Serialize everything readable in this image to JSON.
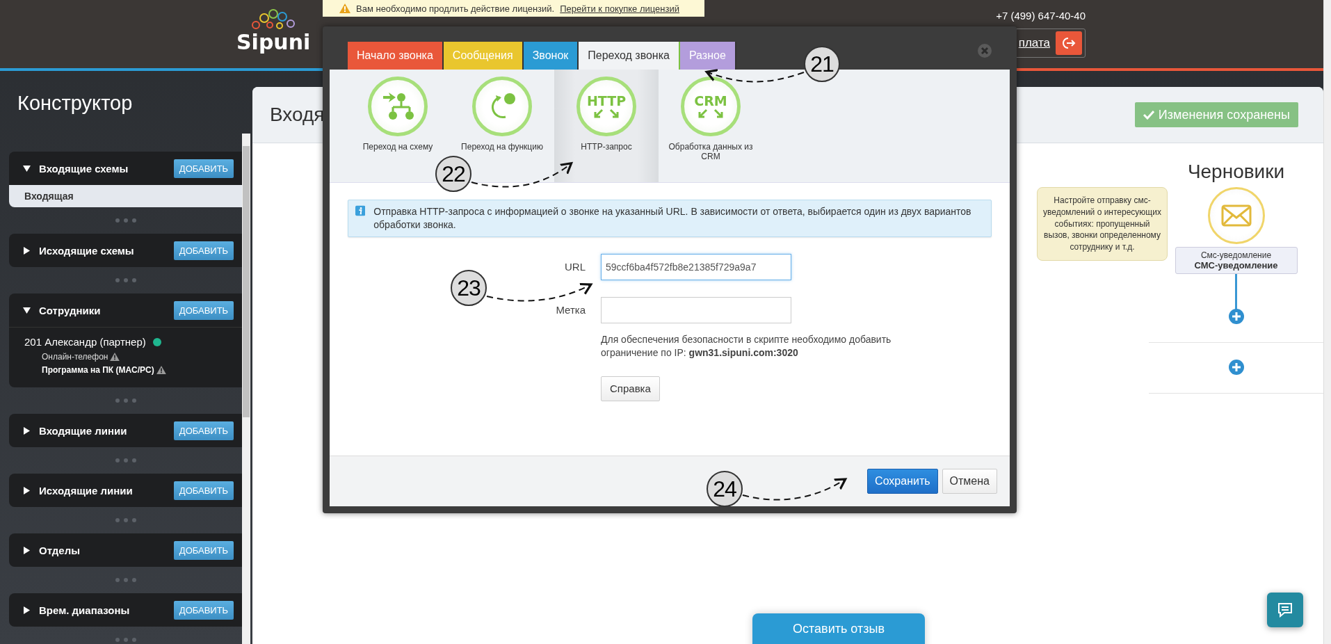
{
  "license_banner": {
    "text": "Вам необходимо продлить действие лицензий.",
    "link": "Перейти к покупке лицензий"
  },
  "logo": {
    "text": "Sipuni"
  },
  "header": {
    "phone": "+7 (499) 647-40-40",
    "account_link": "плата"
  },
  "sidebar": {
    "title": "Конструктор",
    "sections": [
      {
        "title": "Входящие схемы",
        "expanded": true,
        "button": "ДОБАВИТЬ",
        "items": [
          {
            "label": "Входящая",
            "selected": true
          }
        ]
      },
      {
        "title": "Исходящие схемы",
        "expanded": false,
        "button": "ДОБАВИТЬ"
      },
      {
        "title": "Сотрудники",
        "expanded": true,
        "button": "ДОБАВИТЬ",
        "employees": [
          {
            "name": "201 Александр (партнер)",
            "color": "#1fb68f",
            "devices": [
              {
                "label": "Онлайн-телефон",
                "primary": false
              },
              {
                "label": "Программа на ПК (MAC/PC)",
                "primary": true
              }
            ]
          }
        ]
      },
      {
        "title": "Входящие линии",
        "expanded": false,
        "button": "ДОБАВИТЬ"
      },
      {
        "title": "Исходящие линии",
        "expanded": false,
        "button": "ДОБАВИТЬ"
      },
      {
        "title": "Отделы",
        "expanded": false,
        "button": "ДОБАВИТЬ"
      },
      {
        "title": "Врем. диапазоны",
        "expanded": false,
        "button": "ДОБАВИТЬ"
      }
    ]
  },
  "main": {
    "title": "Входя",
    "status_button": "Изменения сохранены",
    "hint": "Настройте отправку смс-уведомлений о интересующих событиях: пропущенный вызов, звонки определенному сотруднику и т.д.",
    "drafts": {
      "title": "Черновики",
      "node": {
        "type": "Смс-уведомление",
        "name": "СМС-уведомление"
      }
    },
    "feedback_button": "Оставить отзыв"
  },
  "modal": {
    "tabs": [
      {
        "label": "Начало звонка",
        "color": "#e9573a",
        "selected": false
      },
      {
        "label": "Сообщения",
        "color": "#e9c62e",
        "selected": false
      },
      {
        "label": "Звонок",
        "color": "#2b9bd4",
        "selected": false
      },
      {
        "label": "Переход звонка",
        "color": "#f1f3f5",
        "selected": true
      },
      {
        "label": "Разное",
        "color": "#b39ddc",
        "selected": false
      }
    ],
    "options": [
      {
        "kind": "scheme",
        "label": "Переход на схему",
        "selected": false
      },
      {
        "kind": "function",
        "label": "Переход на функцию",
        "selected": false
      },
      {
        "kind": "badge",
        "badge_text": "HTTP",
        "label": "HTTP-запрос",
        "selected": true
      },
      {
        "kind": "badge",
        "badge_text": "CRM",
        "label": "Обработка данных из CRM",
        "selected": false
      }
    ],
    "info": "Отправка HTTP-запроса с информацией о звонке на указанный URL. В зависимости от ответа, выбирается один из двух вариантов обработки звонка.",
    "fields": [
      {
        "label": "URL",
        "value": "59ccf6ba4f572fb8e21385f729a9a7",
        "focused": true
      },
      {
        "label": "Метка",
        "focused": false
      }
    ],
    "note": "Для обеспечения безопасности в скрипте необходимо добавить ограничение по IP: **gwn31.sipuni.com:3020**",
    "help_button": "Справка",
    "buttons": [
      {
        "label": "Сохранить",
        "primary": true
      },
      {
        "label": "Отмена",
        "primary": false
      }
    ]
  },
  "callouts": [
    {
      "label": "21"
    },
    {
      "label": "22"
    },
    {
      "label": "23"
    },
    {
      "label": "24"
    }
  ]
}
